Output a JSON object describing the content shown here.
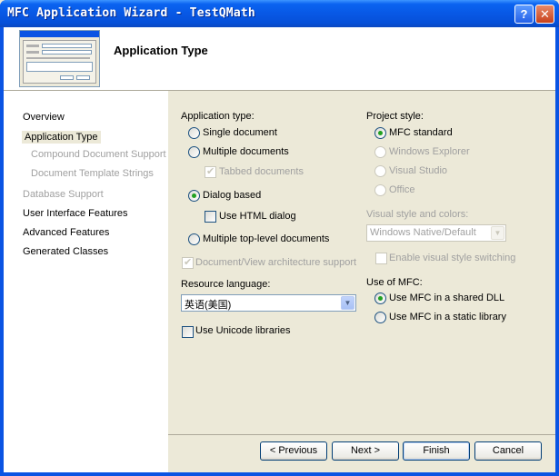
{
  "window": {
    "title": "MFC Application Wizard - TestQMath",
    "help_glyph": "?",
    "close_glyph": "✕"
  },
  "header": {
    "title": "Application Type",
    "preview_icon": "dialog-preview-thumbnail"
  },
  "nav": {
    "items": [
      {
        "label": "Overview",
        "state": "normal"
      },
      {
        "label": "Application Type",
        "state": "selected"
      },
      {
        "label": "Compound Document Support",
        "state": "disabled"
      },
      {
        "label": "Document Template Strings",
        "state": "disabled"
      },
      {
        "label": "Database Support",
        "state": "disabled"
      },
      {
        "label": "User Interface Features",
        "state": "normal"
      },
      {
        "label": "Advanced Features",
        "state": "normal"
      },
      {
        "label": "Generated Classes",
        "state": "normal"
      }
    ]
  },
  "app_type": {
    "group_label": "Application type:",
    "single_document": "Single document",
    "multiple_documents": "Multiple documents",
    "tabbed_documents": "Tabbed documents",
    "dialog_based": "Dialog based",
    "use_html_dialog": "Use HTML dialog",
    "multiple_top_level": "Multiple top-level documents",
    "doc_view_support": "Document/View architecture support",
    "resource_language_label": "Resource language:",
    "resource_language_value": "英语(美国)",
    "use_unicode": "Use Unicode libraries"
  },
  "project_style": {
    "group_label": "Project style:",
    "mfc_standard": "MFC standard",
    "windows_explorer": "Windows Explorer",
    "visual_studio": "Visual Studio",
    "office": "Office",
    "visual_style_label": "Visual style and colors:",
    "visual_style_value": "Windows Native/Default",
    "enable_visual_style_switching": "Enable visual style switching"
  },
  "use_of_mfc": {
    "group_label": "Use of MFC:",
    "shared_dll": "Use MFC in a shared DLL",
    "static_library": "Use MFC in a static library"
  },
  "buttons": {
    "previous": "< Previous",
    "next": "Next >",
    "finish": "Finish",
    "cancel": "Cancel"
  },
  "colors": {
    "titlebar": "#0A54E3",
    "dialog_face": "#ECE9D8",
    "check_mark": "#21A121",
    "disabled_text": "#A0A0A0"
  }
}
